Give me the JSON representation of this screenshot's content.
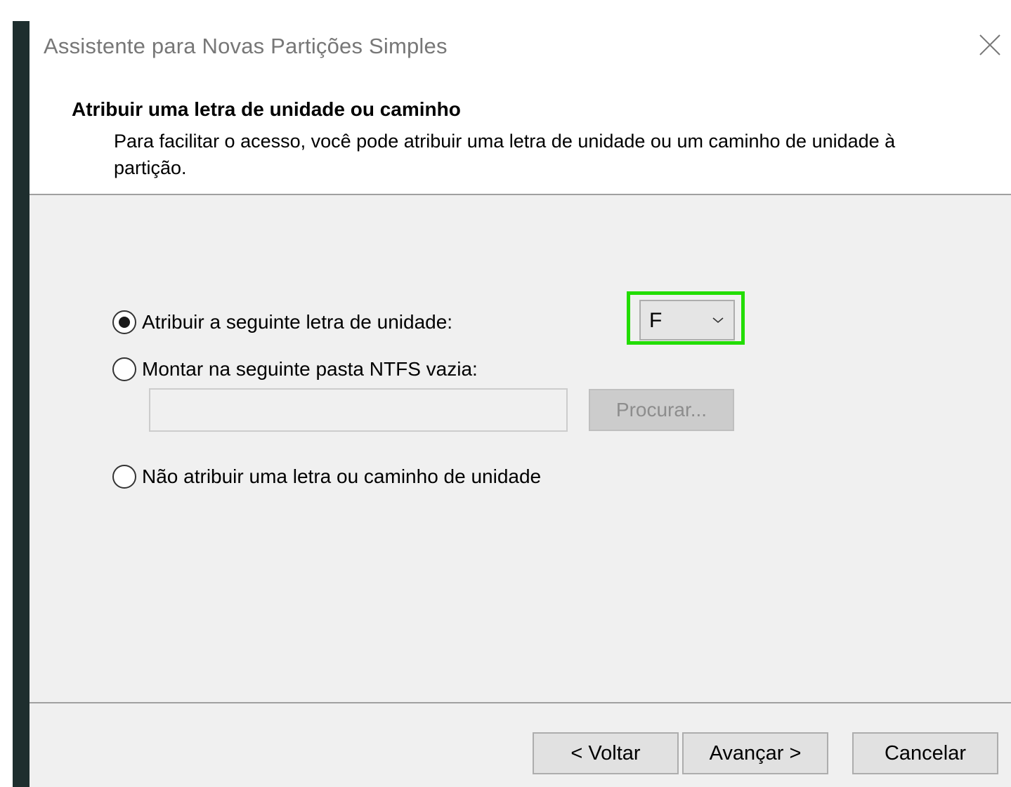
{
  "window": {
    "title": "Assistente para Novas Partições Simples",
    "close_icon": "close-icon"
  },
  "header": {
    "title": "Atribuir uma letra de unidade ou caminho",
    "description": "Para facilitar o acesso, você pode atribuir uma letra de unidade ou um caminho de unidade à partição."
  },
  "options": {
    "assign_letter": {
      "label": "Atribuir a seguinte letra de unidade:",
      "checked": true
    },
    "mount_folder": {
      "label": "Montar na seguinte pasta NTFS vazia:",
      "checked": false,
      "input_value": "",
      "browse_label": "Procurar..."
    },
    "no_assign": {
      "label": "Não atribuir uma letra ou caminho de unidade",
      "checked": false
    }
  },
  "drive_letter": {
    "selected": "F",
    "highlight_color": "#22dd00"
  },
  "footer": {
    "back_label": "< Voltar",
    "next_label": "Avançar >",
    "cancel_label": "Cancelar"
  }
}
